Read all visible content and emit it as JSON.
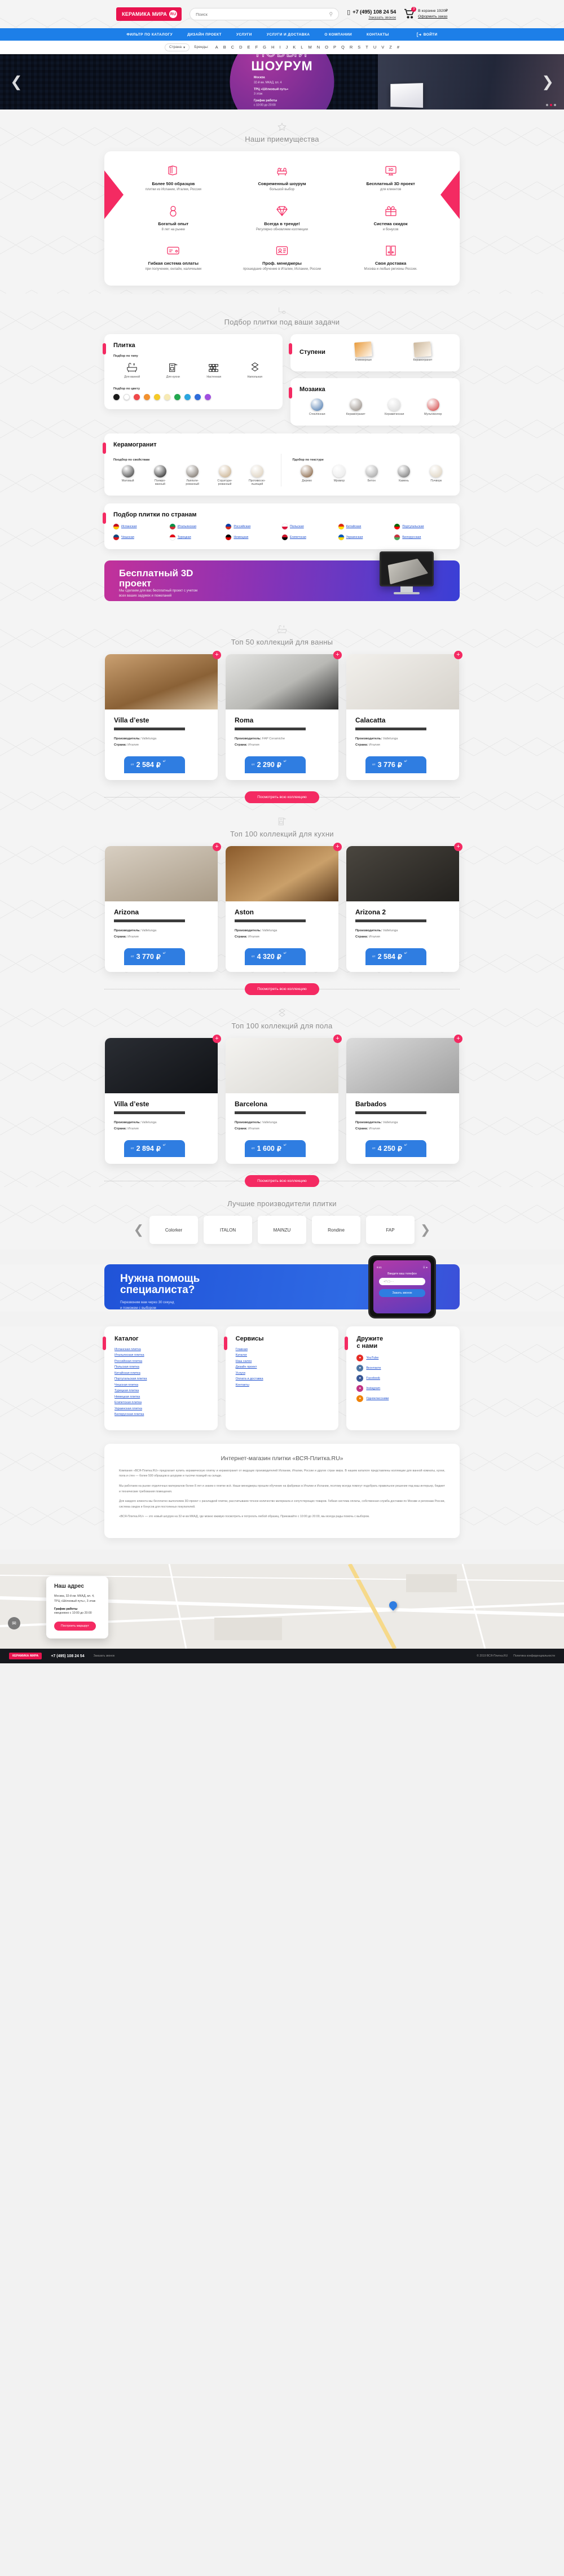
{
  "header": {
    "logo_text": "КЕРАМИКА МИРА",
    "logo_badge": "RU",
    "search_placeholder": "Поиск",
    "search_value": "",
    "search_icon": "search-icon",
    "phone": "+7 (495) 108 24 54",
    "phone_sub": "Заказать звонок",
    "cart_count": "3",
    "cart_label": "В корзине 1920₽",
    "cart_link": "Оформить заказ"
  },
  "nav": {
    "items": [
      "ФИЛЬТР ПО КАТАЛОГУ",
      "ДИЗАЙН ПРОЕКТ",
      "УСЛУГИ",
      "УСЛУГИ И ДОСТАВКА",
      "О КОМПАНИИ",
      "КОНТАКТЫ"
    ],
    "login": "Войти"
  },
  "brandbar": {
    "country_select": "Страна",
    "brands_label": "Бренды:",
    "letters": [
      "A",
      "B",
      "C",
      "D",
      "E",
      "F",
      "G",
      "H",
      "I",
      "J",
      "K",
      "L",
      "M",
      "N",
      "O",
      "P",
      "Q",
      "R",
      "S",
      "T",
      "U",
      "V",
      "Z",
      "#"
    ]
  },
  "hero": {
    "kicker": "НОВЫЙ",
    "title": "ШОУРУМ",
    "city_label": "Москва",
    "city_addr": "32-й км. МКАД, вл. 4",
    "mall_label": "ТРЦ «Шёлковый путь»",
    "mall_floor": "3 этаж",
    "hours_label": "График работы",
    "hours_value": "с 10:00 до 20:00",
    "dots": 3,
    "active_dot": 2
  },
  "advantages": {
    "heading": "Наши приемущества",
    "items": [
      {
        "icon": "catalog-icon",
        "title": "Более 500 образцов",
        "sub": "плитки из Испании, Италии, России"
      },
      {
        "icon": "armchair-icon",
        "title": "Современный шоурум",
        "sub": "большой выбор"
      },
      {
        "icon": "monitor-3d-icon",
        "title": "Бесплатный 3D проект",
        "sub": "для клиентов"
      },
      {
        "icon": "infinity-icon",
        "title": "Богатый опыт",
        "sub": "8 лет на рынке"
      },
      {
        "icon": "diamond-icon",
        "title": "Всегда в тренде!",
        "sub": "Регулярно обновляем коллекции"
      },
      {
        "icon": "gift-icon",
        "title": "Система скидок",
        "sub": "и бонусов"
      },
      {
        "icon": "card-icon",
        "title": "Гибкая система оплаты",
        "sub": "при получении, онлайн, наличными"
      },
      {
        "icon": "badge-id-icon",
        "title": "Проф. менеджеры",
        "sub": "прошедшие обучение в Италии, Испании, России"
      },
      {
        "icon": "truck-icon",
        "title": "Своя доставка",
        "sub": "Москва и любые регионы России."
      }
    ]
  },
  "selector": {
    "heading": "Подбор плитки под ваши задачи",
    "heading_icon": "settings-corner-icon",
    "tile": {
      "title": "Плитка",
      "type_label": "Подбор по типу",
      "types": [
        {
          "icon": "bathtub-icon",
          "label": "Для ванной"
        },
        {
          "icon": "kitchen-icon",
          "label": "Для кухни"
        },
        {
          "icon": "wall-icon",
          "label": "Настенная"
        },
        {
          "icon": "floor-icon",
          "label": "Напольная"
        }
      ],
      "color_label": "Подбор по цвету",
      "colors": [
        "#1b1b1b",
        "#ffffff",
        "#f0484a",
        "#f2912f",
        "#f5c927",
        "#f7eab4",
        "#22a84f",
        "#2ba6e0",
        "#2f6ddb",
        "#a14fe0"
      ]
    },
    "steps": {
      "title": "Ступени",
      "items": [
        {
          "label": "Клинкерные",
          "color": "#e89b3c"
        },
        {
          "label": "Керамогранит",
          "color": "#cbb79c"
        }
      ]
    },
    "mosaic": {
      "title": "Мозаика",
      "items": [
        {
          "label": "Стеклянная",
          "color": "#3e6fa8"
        },
        {
          "label": "Керамогранит",
          "color": "#8c8279"
        },
        {
          "label": "Керамическая",
          "color": "#d8d8d8"
        },
        {
          "label": "Мультиколор",
          "color": "#d03a3a"
        }
      ]
    },
    "porcelain": {
      "title": "Керамогранит",
      "prop_label": "Поодбор по свойствам",
      "props": [
        {
          "label": "Матовый",
          "color": "#2e2e2e"
        },
        {
          "label": "Полиро-\nванный",
          "color": "#111111"
        },
        {
          "label": "Лаппати-\nрованный",
          "color": "#6b6259"
        },
        {
          "label": "Структури-\nрованный",
          "color": "#c3a883"
        },
        {
          "label": "Противоско-\nльзящий",
          "color": "#d8cbb6"
        }
      ],
      "texture_label": "Пдобор по текстуре",
      "textures": [
        {
          "label": "Дерево",
          "color": "#7a5330"
        },
        {
          "label": "Мрамор",
          "color": "#e8e8e8"
        },
        {
          "label": "Бетон",
          "color": "#9a9a9a"
        },
        {
          "label": "Камень",
          "color": "#6a6a6a"
        },
        {
          "label": "Пэчворк",
          "color": "#d9cdb8"
        }
      ]
    },
    "countries": {
      "title": "Подбор плитки по странам",
      "items": [
        {
          "label": "Испанская",
          "c1": "#c60b1e",
          "c2": "#ffc400"
        },
        {
          "label": "Итальянская",
          "c1": "#009246",
          "c2": "#ce2b37"
        },
        {
          "label": "Российская",
          "c1": "#0039a6",
          "c2": "#d52b1e"
        },
        {
          "label": "Польская",
          "c1": "#ffffff",
          "c2": "#dc143c"
        },
        {
          "label": "Китайская",
          "c1": "#de2910",
          "c2": "#ffde00"
        },
        {
          "label": "Португальская",
          "c1": "#006600",
          "c2": "#ff0000"
        },
        {
          "label": "Чешская",
          "c1": "#11457e",
          "c2": "#d7141a"
        },
        {
          "label": "Турецкая",
          "c1": "#e30a17",
          "c2": "#ffffff"
        },
        {
          "label": "Немецкая",
          "c1": "#000000",
          "c2": "#dd0000"
        },
        {
          "label": "Египетская",
          "c1": "#ce1126",
          "c2": "#000000"
        },
        {
          "label": "Украинская",
          "c1": "#0057b7",
          "c2": "#ffd700"
        },
        {
          "label": "Белорусская",
          "c1": "#c8313e",
          "c2": "#4aa657"
        }
      ]
    }
  },
  "banner3d": {
    "title": "Бесплатный 3D\nпроект",
    "text": "Мы сделаем для вас бесплатный проект с учетом\nвсех ваших задумок и пожеланий"
  },
  "collections": [
    {
      "heading": "Топ 50 коллекций для ванны",
      "heading_icon": "bathtub-icon",
      "button": "Посмотреть всю коллекцию",
      "items": [
        {
          "name": "Villa d’este",
          "maker_label": "Производитель:",
          "maker": "Vallelunga",
          "country_label": "Страна:",
          "country": "Италия",
          "price_prefix": "от",
          "price": "2 584",
          "currency": "₽",
          "unit": "м²",
          "img": "warm-wood-bath"
        },
        {
          "name": "Roma",
          "maker_label": "Производитель:",
          "maker": "FAP Ceramiche",
          "country_label": "Страна:",
          "country": "Италия",
          "price_prefix": "от",
          "price": "2 290",
          "currency": "₽",
          "unit": "м²",
          "img": "grey-marble-bath"
        },
        {
          "name": "Calacatta",
          "maker_label": "Производитель:",
          "maker": "Vallelunga",
          "country_label": "Страна:",
          "country": "Италия",
          "price_prefix": "от",
          "price": "3 776",
          "currency": "₽",
          "unit": "м²",
          "img": "white-mosaic-bath"
        }
      ]
    },
    {
      "heading": "Топ 100 коллекций для кухни",
      "heading_icon": "kitchen-icon",
      "button": "Посмотреть всю коллекцию",
      "items": [
        {
          "name": "Arizona",
          "maker_label": "Производитель:",
          "maker": "Vallelunga",
          "country_label": "Страна:",
          "country": "Италия",
          "price_prefix": "от",
          "price": "3 770",
          "currency": "₽",
          "unit": "м²",
          "img": "light-kitchen"
        },
        {
          "name": "Aston",
          "maker_label": "Производитель:",
          "maker": "Vallelunga",
          "country_label": "Страна:",
          "country": "Италия",
          "price_prefix": "от",
          "price": "4 320",
          "currency": "₽",
          "unit": "м²",
          "img": "wood-parquet-kitchen"
        },
        {
          "name": "Arizona 2",
          "maker_label": "Производитель:",
          "maker": "Vallelunga",
          "country_label": "Страна:",
          "country": "Италия",
          "price_prefix": "от",
          "price": "2 584",
          "currency": "₽",
          "unit": "м²",
          "img": "dark-kitchen"
        }
      ]
    },
    {
      "heading": "Топ 100 коллекций для пола",
      "heading_icon": "floor-icon",
      "button": "Посмотреть всю коллекцию",
      "items": [
        {
          "name": "Villa d’este",
          "maker_label": "Производитель:",
          "maker": "Vallelunga",
          "country_label": "Страна:",
          "country": "Италия",
          "price_prefix": "от",
          "price": "2 894",
          "currency": "₽",
          "unit": "м²",
          "img": "black-gloss-floor"
        },
        {
          "name": "Barcelona",
          "maker_label": "Производитель:",
          "maker": "Vallelunga",
          "country_label": "Страна:",
          "country": "Италия",
          "price_prefix": "от",
          "price": "1 600",
          "currency": "₽",
          "unit": "м²",
          "img": "white-black-diamond-floor"
        },
        {
          "name": "Barbados",
          "maker_label": "Производитель:",
          "maker": "Vallelunga",
          "country_label": "Страна:",
          "country": "Италия",
          "price_prefix": "от",
          "price": "4 250",
          "currency": "₽",
          "unit": "м²",
          "img": "grey-octagon-floor"
        }
      ]
    }
  ],
  "manufacturers": {
    "heading": "Лучшие производители плитки",
    "prev_icon": "chevron-left-icon",
    "next_icon": "chevron-right-icon",
    "items": [
      "Colorker",
      "ITALON",
      "MAINZU",
      "Rondine",
      "FAP"
    ]
  },
  "help": {
    "title": "Нужна помощь\nспециалиста?",
    "text": "Перезвоним вам через 30 секунд\nи поможем с выбором",
    "phone_time": "9:41",
    "form_label": "Введите ваш телефон",
    "input_placeholder": "+7 (    )    -   -",
    "button": "Закать звонок"
  },
  "footer": {
    "catalog": {
      "title": "Каталог",
      "links": [
        "Испанская плитка",
        "Итальянская плитка",
        "Российская плитка",
        "Польская плитка",
        "Китайская плитка",
        "Португальская плитка",
        "Чешская плитка",
        "Турецкая плитка",
        "Немецкая плитка",
        "Египетская плитка",
        "Украинская плитка",
        "Белорусская плитка"
      ]
    },
    "services": {
      "title": "Сервисы",
      "links": [
        "Главная",
        "Каталог",
        "Наш салон",
        "Дизайн проект",
        "Услуги",
        "Оплата и доставка",
        "Контакты"
      ]
    },
    "social": {
      "title": "Дружите\nс нами",
      "links": [
        {
          "label": "YouTube",
          "icon": "youtube-icon",
          "color": "#e52d27"
        },
        {
          "label": "Вконтакте",
          "icon": "vk-icon",
          "color": "#4c75a3"
        },
        {
          "label": "Facebook",
          "icon": "facebook-icon",
          "color": "#3b5998"
        },
        {
          "label": "Instagram",
          "icon": "instagram-icon",
          "color": "#c13584"
        },
        {
          "label": "Одноклассники",
          "icon": "ok-icon",
          "color": "#ee8208"
        }
      ]
    }
  },
  "about": {
    "title": "Интернет-магазин плитки «ВСЯ-Плитка.RU»",
    "paragraphs": [
      "Компания «ВСЯ-Плитка.RU» предлагает купить керамическую плитку и керамогранит от ведущих производителей Испании, Италии, России и других стран мира. В нашем каталоге представлены коллекции для ванной комнаты, кухни, пола и стен — более 500 образцов в шоуруме и тысячи позиций на складе.",
      "Мы работаем на рынке отделочных материалов более 8 лет и знаем о плитке всё. Наши менеджеры прошли обучение на фабриках в Италии и Испании, поэтому всегда помогут подобрать правильное решение под ваш интерьер, бюджет и технические требования помещения.",
      "Для каждого клиента мы бесплатно выполняем 3D-проект с раскладкой плитки, рассчитываем точное количество материала и сопутствующих товаров. Гибкая система оплаты, собственная служба доставки по Москве и регионам России, система скидок и бонусов для постоянных покупателей.",
      "«ВСЯ-Плитка.RU» — это новый шоурум на 32-м км МКАД, где можно вживую посмотреть и потрогать любой образец. Приезжайте с 10:00 до 20:00, мы всегда рады помочь с выбором."
    ]
  },
  "map": {
    "card_title": "Наш адрес",
    "address": "Москва, 32-й км. МКАД, вл. 4,\nТРЦ «Шёлковый путь», 3 этаж",
    "hours_label": "График работы",
    "hours_value": "ежедневно с 10:00 до 20:00",
    "button": "Построить маршрут",
    "pin_icon": "map-pin-icon"
  },
  "bottombar": {
    "logo_text": "КЕРАМИКА МИРА",
    "phone": "+7 (495) 108 24 54",
    "callback": "Заказать звонок",
    "copyright": "© 2019 ВСЯ-Плитка.RU",
    "policy": "Политика конфиденциальности",
    "chat_icon": "chat-icon"
  }
}
